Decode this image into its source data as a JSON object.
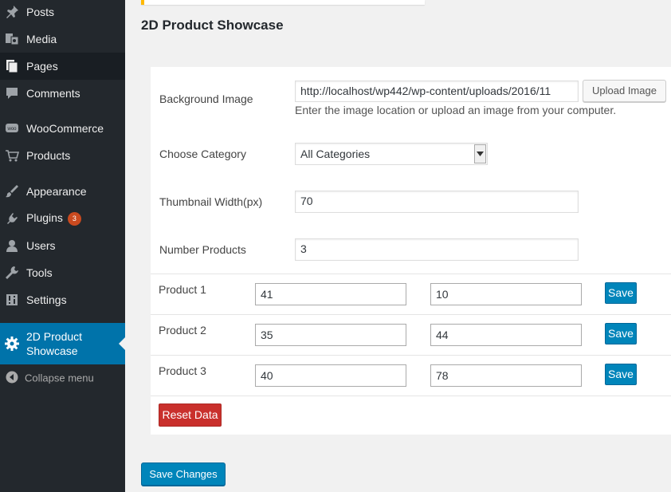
{
  "colors": {
    "sidebar_bg": "#23282d",
    "active_menu_bg": "#0073aa",
    "primary_button": "#0085ba",
    "danger_button": "#c9302c",
    "badge": "#ca4a1f"
  },
  "sidebar": {
    "items": [
      {
        "label": "Posts",
        "icon": "pushpin-icon"
      },
      {
        "label": "Media",
        "icon": "media-icon"
      },
      {
        "label": "Pages",
        "icon": "pages-icon"
      },
      {
        "label": "Comments",
        "icon": "comment-icon"
      },
      {
        "label": "WooCommerce",
        "icon": "woocommerce-icon"
      },
      {
        "label": "Products",
        "icon": "cart-icon"
      },
      {
        "label": "Appearance",
        "icon": "paintbrush-icon"
      },
      {
        "label": "Plugins",
        "icon": "plugin-icon",
        "badge": "3"
      },
      {
        "label": "Users",
        "icon": "user-icon"
      },
      {
        "label": "Tools",
        "icon": "wrench-icon"
      },
      {
        "label": "Settings",
        "icon": "settings-icon"
      },
      {
        "label": "2D Product Showcase",
        "icon": "gear-icon"
      }
    ],
    "collapse_label": "Collapse menu"
  },
  "page": {
    "title": "2D Product Showcase"
  },
  "form": {
    "background_image": {
      "label": "Background Image",
      "value": "http://localhost/wp442/wp-content/uploads/2016/11",
      "upload_button": "Upload Image",
      "help": "Enter the image location or upload an image from your computer."
    },
    "category": {
      "label": "Choose Category",
      "selected": "All Categories"
    },
    "thumbnail_width": {
      "label": "Thumbnail Width(px)",
      "value": "70"
    },
    "number_products": {
      "label": "Number Products",
      "value": "3"
    }
  },
  "products": [
    {
      "label": "Product 1",
      "value1": "41",
      "value2": "10",
      "save_label": "Save"
    },
    {
      "label": "Product 2",
      "value1": "35",
      "value2": "44",
      "save_label": "Save"
    },
    {
      "label": "Product 3",
      "value1": "40",
      "value2": "78",
      "save_label": "Save"
    }
  ],
  "reset_label": "Reset Data",
  "save_changes_label": "Save Changes"
}
